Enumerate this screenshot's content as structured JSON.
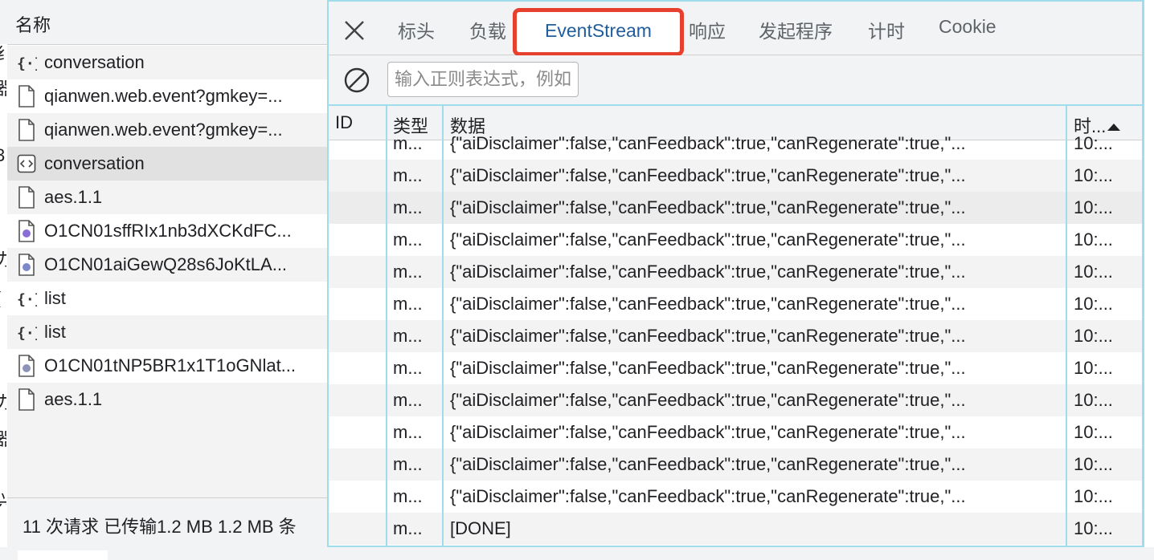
{
  "left_panel": {
    "header": "名称",
    "edge_glyphs": [
      "纟",
      "器",
      "3",
      "力",
      "(",
      "力",
      "器",
      "兴"
    ],
    "requests": [
      {
        "name": "conversation",
        "icon": "json-braces-icon"
      },
      {
        "name": "qianwen.web.event?gmkey=...",
        "icon": "document-icon"
      },
      {
        "name": "qianwen.web.event?gmkey=...",
        "icon": "document-icon"
      },
      {
        "name": "conversation",
        "icon": "code-brackets-icon"
      },
      {
        "name": "aes.1.1",
        "icon": "document-icon"
      },
      {
        "name": "O1CN01sffRIx1nb3dXCKdFC...",
        "icon": "image-file-icon"
      },
      {
        "name": "O1CN01aiGewQ28s6JoKtLA...",
        "icon": "image-file-icon"
      },
      {
        "name": "list",
        "icon": "json-braces-icon"
      },
      {
        "name": "list",
        "icon": "json-braces-icon"
      },
      {
        "name": "O1CN01tNP5BR1x1T1oGNlat...",
        "icon": "image-file-icon"
      },
      {
        "name": "aes.1.1",
        "icon": "document-icon"
      }
    ],
    "status": "11 次请求  已传输1.2 MB  1.2 MB 条"
  },
  "tabs": {
    "items": [
      "标头",
      "负载",
      "EventStream",
      "响应",
      "发起程序",
      "计时",
      "Cookie"
    ],
    "active": "EventStream"
  },
  "filter": {
    "placeholder": "输入正则表达式，例如"
  },
  "grid": {
    "columns": [
      "ID",
      "类型",
      "数据",
      "时..."
    ],
    "rows": [
      {
        "id": "",
        "type": "m...",
        "data": "{\"aiDisclaimer\":false,\"canFeedback\":true,\"canRegenerate\":true,\"...",
        "time": "10:..."
      },
      {
        "id": "",
        "type": "m...",
        "data": "{\"aiDisclaimer\":false,\"canFeedback\":true,\"canRegenerate\":true,\"...",
        "time": "10:..."
      },
      {
        "id": "",
        "type": "m...",
        "data": "{\"aiDisclaimer\":false,\"canFeedback\":true,\"canRegenerate\":true,\"...",
        "time": "10:..."
      },
      {
        "id": "",
        "type": "m...",
        "data": "{\"aiDisclaimer\":false,\"canFeedback\":true,\"canRegenerate\":true,\"...",
        "time": "10:..."
      },
      {
        "id": "",
        "type": "m...",
        "data": "{\"aiDisclaimer\":false,\"canFeedback\":true,\"canRegenerate\":true,\"...",
        "time": "10:..."
      },
      {
        "id": "",
        "type": "m...",
        "data": "{\"aiDisclaimer\":false,\"canFeedback\":true,\"canRegenerate\":true,\"...",
        "time": "10:..."
      },
      {
        "id": "",
        "type": "m...",
        "data": "{\"aiDisclaimer\":false,\"canFeedback\":true,\"canRegenerate\":true,\"...",
        "time": "10:..."
      },
      {
        "id": "",
        "type": "m...",
        "data": "{\"aiDisclaimer\":false,\"canFeedback\":true,\"canRegenerate\":true,\"...",
        "time": "10:..."
      },
      {
        "id": "",
        "type": "m...",
        "data": "{\"aiDisclaimer\":false,\"canFeedback\":true,\"canRegenerate\":true,\"...",
        "time": "10:..."
      },
      {
        "id": "",
        "type": "m...",
        "data": "{\"aiDisclaimer\":false,\"canFeedback\":true,\"canRegenerate\":true,\"...",
        "time": "10:..."
      },
      {
        "id": "",
        "type": "m...",
        "data": "{\"aiDisclaimer\":false,\"canFeedback\":true,\"canRegenerate\":true,\"...",
        "time": "10:..."
      },
      {
        "id": "",
        "type": "m...",
        "data": "{\"aiDisclaimer\":false,\"canFeedback\":true,\"canRegenerate\":true,\"...",
        "time": "10:..."
      },
      {
        "id": "",
        "type": "m...",
        "data": "[DONE]",
        "time": "10:..."
      }
    ]
  },
  "colors": {
    "highlight_border": "#e8402f",
    "panel_border": "#9fdcec",
    "active_tab_text": "#1f5d9c"
  }
}
